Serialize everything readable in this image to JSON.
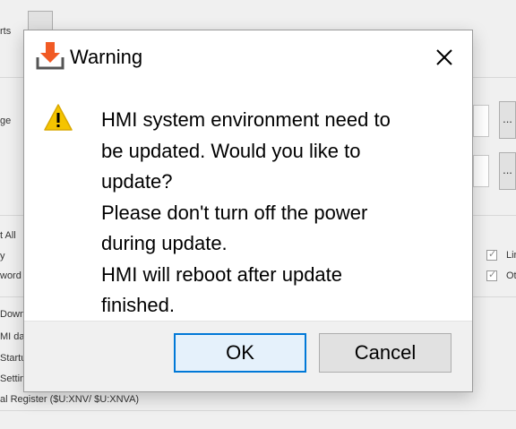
{
  "background": {
    "fragments": {
      "f1": "rts",
      "f2": "ge",
      "f3": "t All",
      "f4": "y",
      "f5": "word",
      "f6": "Downl",
      "f7": "MI da",
      "f8": "Startu",
      "f9": "Settin",
      "f10": "al Register ($U:XNV/ $U:XNVA)",
      "f11": "Lir",
      "f12": "Ot"
    },
    "browse_label": "..."
  },
  "dialog": {
    "title": "Warning",
    "title_icon": "download-tray-icon",
    "close_icon": "close-icon",
    "message_icon": "warning-triangle-icon",
    "message_lines": [
      "HMI system environment need to",
      "be updated. Would you like to",
      "update?",
      "Please don't turn off the power",
      "during update.",
      "HMI will reboot after update",
      "finished."
    ],
    "buttons": {
      "ok": "OK",
      "cancel": "Cancel"
    }
  },
  "colors": {
    "accent": "#0078d7",
    "download_orange": "#f15a24",
    "warning_yellow": "#f5c400"
  }
}
